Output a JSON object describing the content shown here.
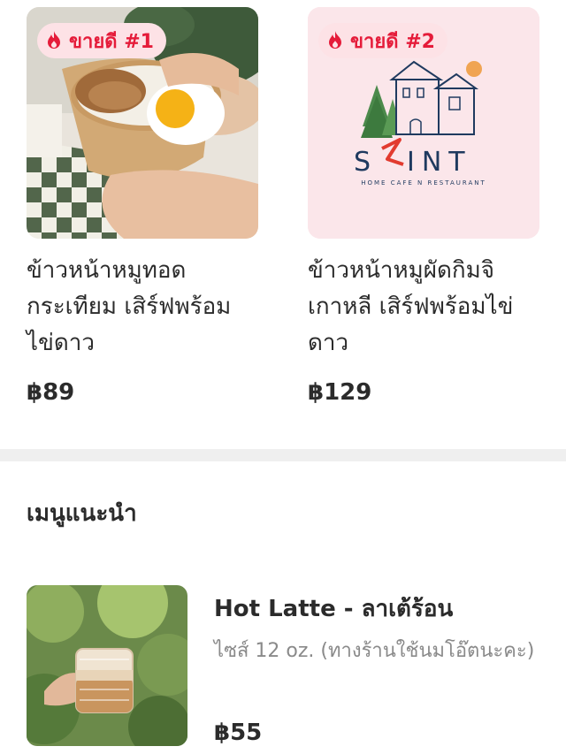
{
  "featured": [
    {
      "badge": "ขายดี #1",
      "title": "ข้าวหน้าหมูทอดกระเทียม เสิร์ฟพร้อมไข่ดาว",
      "price": "฿89",
      "image": "rice-bowl-fried-egg"
    },
    {
      "badge": "ขายดี #2",
      "title": "ข้าวหน้าหมูผัดกิมจิเกาหลี เสิร์ฟพร้อมไข่ดาว",
      "price": "฿129",
      "image": "shop-logo",
      "logo_name": "S INT",
      "logo_tagline": "HOME CAFE N RESTAURANT"
    }
  ],
  "section": {
    "title": "เมนูแนะนำ"
  },
  "recommended": [
    {
      "name": "Hot Latte - ลาเต้ร้อน",
      "description": "ไซส์ 12 oz. (ทางร้านใช้นมโอ๊ตนะคะ)",
      "price": "฿55",
      "image": "latte-glass-in-hand"
    }
  ],
  "colors": {
    "badge_bg": "#fde2e6",
    "badge_text": "#e51c3a",
    "logo_bg": "#fbe6ea",
    "logo_navy": "#1f3a5f",
    "logo_red": "#e23b2f",
    "divider": "#efefef"
  },
  "icons": {
    "badge": "flame-icon"
  }
}
